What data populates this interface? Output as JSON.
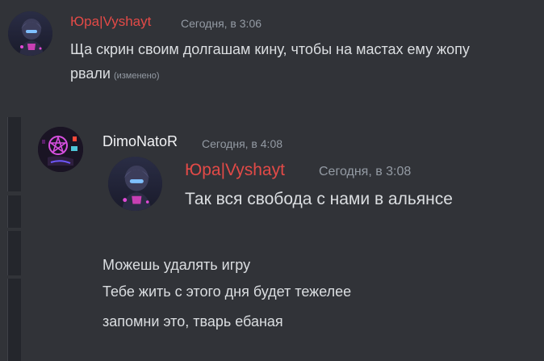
{
  "messages": [
    {
      "author": "Юра|Vyshayt",
      "timestamp": "Сегодня, в 3:06",
      "lines": [
        "Ща скрин своим долгашам кину, чтобы на мастах ему жопу",
        "рвали"
      ],
      "edited_label": "(изменено)",
      "author_color": "#e34a47",
      "avatar_icon": "anime-avatar-icon"
    },
    {
      "author": "DimoNatoR",
      "timestamp": "Сегодня, в 4:08",
      "quoted": {
        "author": "Юра|Vyshayt",
        "timestamp": "Сегодня, в 3:08",
        "text": "Так вся свобода с нами в альянсе",
        "author_color": "#e34a47",
        "avatar_icon": "anime-avatar-icon"
      },
      "lines": [
        "Можешь удалять игру",
        "Тебе жить с этого дня будет тежелее",
        "запомни это, тварь ебаная"
      ],
      "author_color": "#f2f3f5",
      "avatar_icon": "pentagram-avatar-icon"
    }
  ],
  "colors": {
    "background": "#313338",
    "text": "#dbdee1",
    "muted": "#949ba4"
  }
}
